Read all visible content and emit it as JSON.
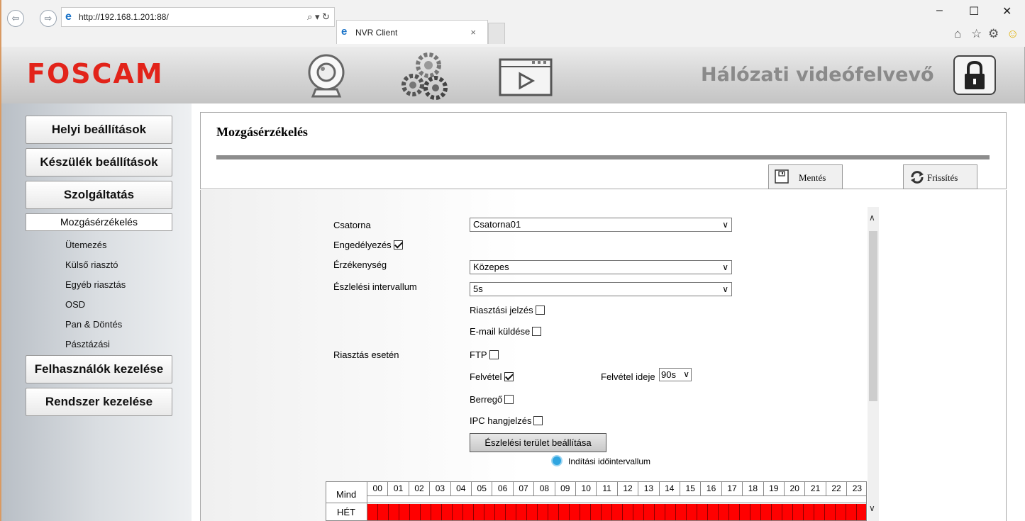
{
  "browser": {
    "url": "http://192.168.1.201:88/",
    "tab_title": "NVR Client",
    "tab_close": "×",
    "url_tools": "⌕ ▾ ↻"
  },
  "header": {
    "logo": "FOSCAM",
    "app_title": "Hálózati videófelvevő",
    "brand_color": "#e2231a"
  },
  "sidebar": {
    "main": [
      "Helyi beállítások",
      "Készülék beállítások",
      "Szolgáltatás"
    ],
    "active_sub": "Mozgásérzékelés",
    "sub": [
      "Ütemezés",
      "Külső riasztó",
      "Egyéb riasztás",
      "OSD",
      "Pan & Döntés",
      "Pásztázási"
    ],
    "bottom": [
      "Felhasználók kezelése",
      "Rendszer kezelése"
    ]
  },
  "page": {
    "title": "Mozgásérzékelés",
    "save": "Mentés",
    "refresh": "Frissítés"
  },
  "form": {
    "channel_label": "Csatorna",
    "channel_value": "Csatorna01",
    "enable_label": "Engedélyezés",
    "enable_checked": true,
    "sensitivity_label": "Érzékenység",
    "sensitivity_value": "Közepes",
    "interval_label": "Észlelési intervallum",
    "interval_value": "5s",
    "on_alarm_label": "Riasztás esetén",
    "alarm_signal": "Riasztási jelzés",
    "email": "E-mail küldése",
    "ftp": "FTP",
    "record": "Felvétel",
    "record_checked": true,
    "record_time_label": "Felvétel ideje",
    "record_time_value": "90s",
    "buzzer": "Berregő",
    "ipc_sound": "IPC hangjelzés",
    "area_button": "Észlelési terület beállítása",
    "start_interval": "Indítási időintervallum"
  },
  "schedule": {
    "all_label": "Mind",
    "day_label": "HÉT",
    "hours": [
      "00",
      "01",
      "02",
      "03",
      "04",
      "05",
      "06",
      "07",
      "08",
      "09",
      "10",
      "11",
      "12",
      "13",
      "14",
      "15",
      "16",
      "17",
      "18",
      "19",
      "20",
      "21",
      "22",
      "23"
    ],
    "active_color": "#ff0000"
  }
}
